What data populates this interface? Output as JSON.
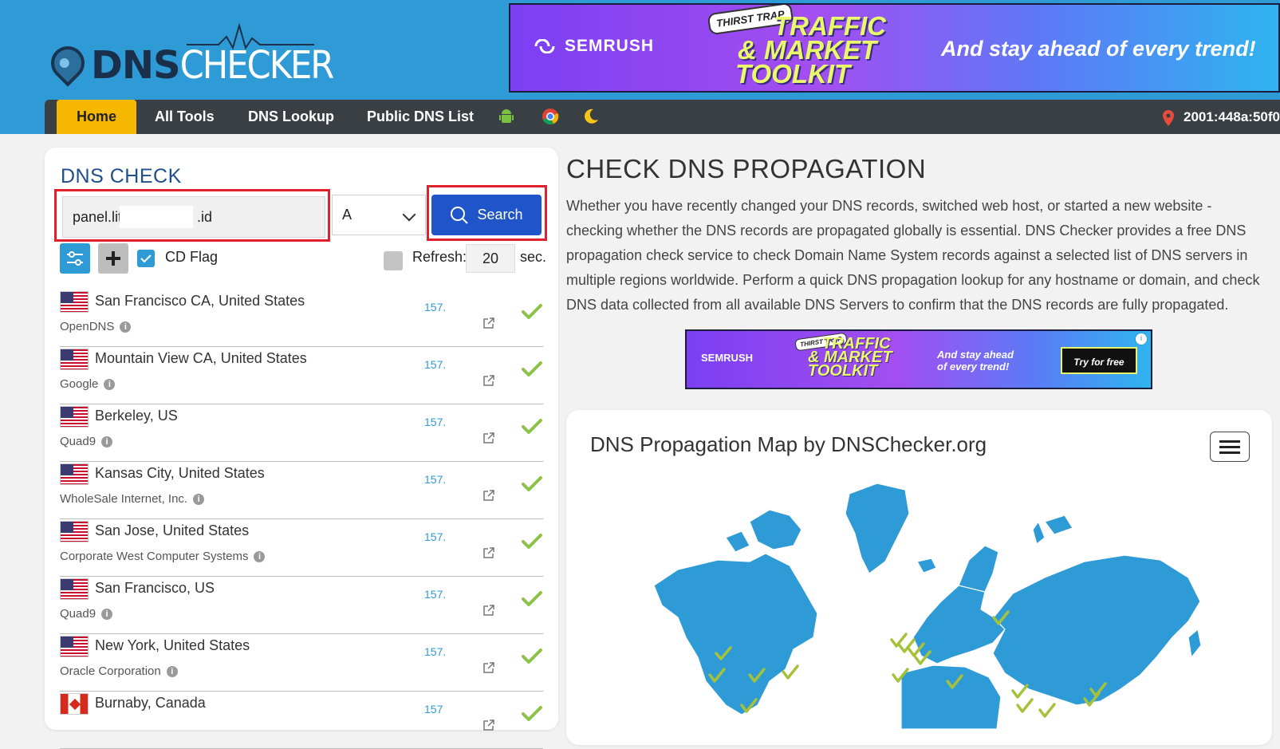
{
  "header": {
    "logo_dns": "DNS",
    "logo_checker": "CHECKER",
    "ad": {
      "brand": "SEMRUSH",
      "tag": "THIRST TRAP",
      "headline_1": "TRAFFIC",
      "headline_2": "& MARKET",
      "headline_3": "TOOLKIT",
      "slogan": "And stay ahead of every trend!"
    }
  },
  "nav": {
    "items": [
      "Home",
      "All Tools",
      "DNS Lookup",
      "Public DNS List"
    ],
    "icons": [
      "android-icon",
      "chrome-icon",
      "moon-icon"
    ],
    "ip": "2001:448a:50f0"
  },
  "panel": {
    "title": "DNS CHECK",
    "domain_value": "panel.lit",
    "domain_suffix": ".id",
    "record_type": "A",
    "search_label": "Search",
    "cd_flag_label": "CD Flag",
    "refresh_label": "Refresh:",
    "refresh_value": "20",
    "refresh_unit": "sec."
  },
  "results": [
    {
      "city": "San Francisco CA, United States",
      "provider": "OpenDNS",
      "ip": "157.",
      "flag": "us"
    },
    {
      "city": "Mountain View CA, United States",
      "provider": "Google",
      "ip": "157.",
      "flag": "us"
    },
    {
      "city": "Berkeley, US",
      "provider": "Quad9",
      "ip": "157.",
      "flag": "us"
    },
    {
      "city": "Kansas City, United States",
      "provider": "WholeSale Internet, Inc.",
      "ip": "157.",
      "flag": "us"
    },
    {
      "city": "San Jose, United States",
      "provider": "Corporate West Computer Systems",
      "ip": "157.",
      "flag": "us"
    },
    {
      "city": "San Francisco, US",
      "provider": "Quad9",
      "ip": "157.",
      "flag": "us"
    },
    {
      "city": "New York, United States",
      "provider": "Oracle Corporation",
      "ip": "157.",
      "flag": "us"
    },
    {
      "city": "Burnaby, Canada",
      "provider": "",
      "ip": "157",
      "flag": "ca"
    }
  ],
  "content": {
    "heading": "CHECK DNS PROPAGATION",
    "paragraph": "Whether you have recently changed your DNS records, switched web host, or started a new website - checking whether the DNS records are propagated globally is essential. DNS Checker provides a free DNS propagation check service to check Domain Name System records against a selected list of DNS servers in multiple regions worldwide. Perform a quick DNS propagation lookup for any hostname or domain, and check DNS data collected from all available DNS Servers to confirm that the DNS records are fully propagated.",
    "ad": {
      "brand": "SEMRUSH",
      "tag": "THIRST TRAP",
      "headline_1": "TRAFFIC",
      "headline_2": "& MARKET",
      "headline_3": "TOOLKIT",
      "slogan_1": "And stay ahead",
      "slogan_2": "of every trend!",
      "cta": "Try for free"
    },
    "map_title": "DNS Propagation Map by DNSChecker.org"
  },
  "colors": {
    "header_bg": "#2f9bd6",
    "nav_bg": "#3a3f44",
    "home_tab": "#f5b700",
    "search_button": "#1f55c9",
    "highlight": "#e0202a",
    "map_land": "#2f9bd6",
    "tick": "#8bc34a"
  }
}
